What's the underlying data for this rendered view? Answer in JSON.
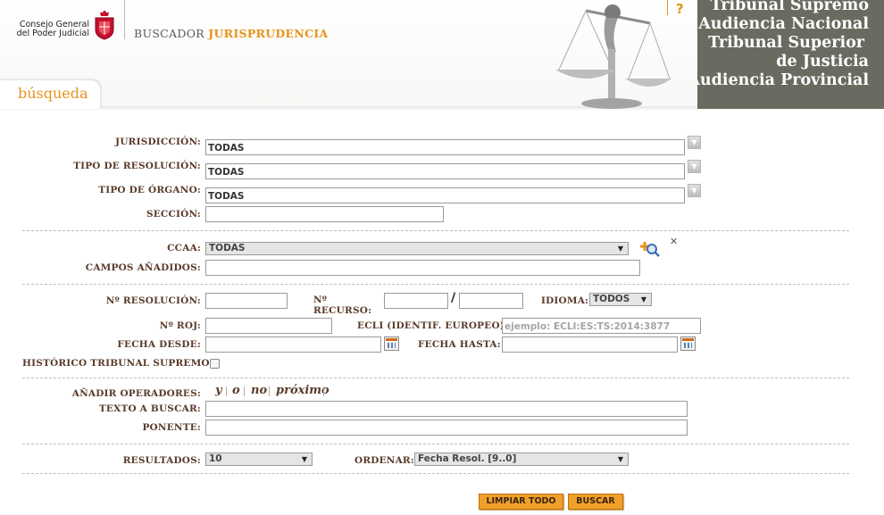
{
  "header": {
    "org_line1": "Consejo General",
    "org_line2": "del Poder Judicial",
    "app_title_prefix": "BUSCADOR",
    "app_title_accent": "JURISPRUDENCIA",
    "help": "?",
    "courts": [
      "Tribunal Supremo",
      "Audiencia Nacional",
      "Tribunal Superior",
      "de Justicia",
      "Audiencia Provincial"
    ],
    "tab_label": "búsqueda"
  },
  "form": {
    "jurisdiccion": {
      "label": "JURISDICCIÓN:",
      "value": "TODAS"
    },
    "tipo_resolucion": {
      "label": "TIPO DE RESOLUCIÓN:",
      "value": "TODAS"
    },
    "tipo_organo": {
      "label": "TIPO DE ÓRGANO:",
      "value": "TODAS"
    },
    "seccion": {
      "label": "SECCIÓN:",
      "value": ""
    },
    "ccaa": {
      "label": "CCAA:",
      "value": "TODAS"
    },
    "campos_anadidos": {
      "label": "CAMPOS AÑADIDOS:",
      "value": ""
    },
    "num_resolucion": {
      "label": "Nº RESOLUCIÓN:",
      "value": ""
    },
    "num_recurso": {
      "label_line1": "Nº",
      "label_line2": "RECURSO:",
      "value1": "",
      "value2": "",
      "separator": "/"
    },
    "idioma": {
      "label": "IDIOMA:",
      "value": "TODOS"
    },
    "num_roj": {
      "label": "Nº ROJ:",
      "value": ""
    },
    "ecli": {
      "label": "ECLI (IDENTIF. EUROPEO):",
      "placeholder": "ejemplo: ECLI:ES:TS:2014:3877"
    },
    "fecha_desde": {
      "label": "FECHA DESDE:",
      "value": ""
    },
    "fecha_hasta": {
      "label": "FECHA HASTA:",
      "value": ""
    },
    "historico": {
      "label": "HISTÓRICO TRIBUNAL SUPREMO:",
      "checked": false
    },
    "operadores": {
      "label": "AÑADIR OPERADORES:",
      "items": [
        "y",
        "o",
        "no",
        "próximo"
      ]
    },
    "texto": {
      "label": "TEXTO A BUSCAR:",
      "value": ""
    },
    "ponente": {
      "label": "PONENTE:",
      "value": ""
    },
    "resultados": {
      "label": "RESULTADOS:",
      "value": "10"
    },
    "ordenar": {
      "label": "ORDENAR:",
      "value": "Fecha Resol. [9..0]"
    }
  },
  "actions": {
    "clear_label": "LIMPIAR TODO",
    "search_label": "BUSCAR"
  },
  "colors": {
    "accent": "#e7921a",
    "label": "#5a3b2a",
    "courts_bg": "#696b60",
    "button": "#f0a028"
  }
}
